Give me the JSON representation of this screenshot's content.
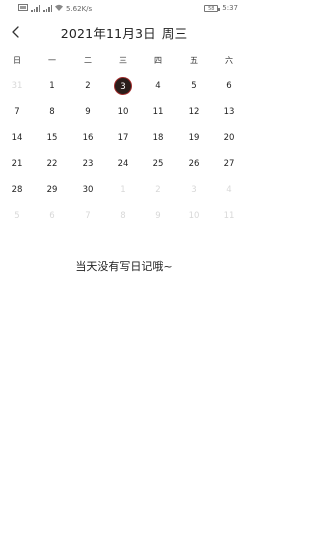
{
  "status_bar": {
    "left_icons": [
      "sim-icon",
      "signal-icon",
      "signal-icon",
      "wifi-icon"
    ],
    "network_speed": "5.62K/s",
    "battery_level": "58",
    "time": "5:37"
  },
  "header": {
    "title_date": "2021年11月3日",
    "title_weekday": "周三",
    "back_icon": "chevron-left-icon"
  },
  "weekdays": [
    "日",
    "一",
    "二",
    "三",
    "四",
    "五",
    "六"
  ],
  "calendar": {
    "selected_day": "3",
    "weeks": [
      [
        {
          "d": "31",
          "o": true
        },
        {
          "d": "1"
        },
        {
          "d": "2"
        },
        {
          "d": "3",
          "sel": true
        },
        {
          "d": "4"
        },
        {
          "d": "5"
        },
        {
          "d": "6"
        }
      ],
      [
        {
          "d": "7"
        },
        {
          "d": "8"
        },
        {
          "d": "9"
        },
        {
          "d": "10"
        },
        {
          "d": "11"
        },
        {
          "d": "12"
        },
        {
          "d": "13"
        }
      ],
      [
        {
          "d": "14"
        },
        {
          "d": "15"
        },
        {
          "d": "16"
        },
        {
          "d": "17"
        },
        {
          "d": "18"
        },
        {
          "d": "19"
        },
        {
          "d": "20"
        }
      ],
      [
        {
          "d": "21"
        },
        {
          "d": "22"
        },
        {
          "d": "23"
        },
        {
          "d": "24"
        },
        {
          "d": "25"
        },
        {
          "d": "26"
        },
        {
          "d": "27"
        }
      ],
      [
        {
          "d": "28"
        },
        {
          "d": "29"
        },
        {
          "d": "30"
        },
        {
          "d": "1",
          "o": true
        },
        {
          "d": "2",
          "o": true
        },
        {
          "d": "3",
          "o": true
        },
        {
          "d": "4",
          "o": true
        }
      ],
      [
        {
          "d": "5",
          "o": true
        },
        {
          "d": "6",
          "o": true
        },
        {
          "d": "7",
          "o": true
        },
        {
          "d": "8",
          "o": true
        },
        {
          "d": "9",
          "o": true
        },
        {
          "d": "10",
          "o": true
        },
        {
          "d": "11",
          "o": true
        }
      ]
    ]
  },
  "empty_message": "当天没有写日记哦~",
  "colors": {
    "selected_fill": "#2a1d1a",
    "selected_ring": "#a02a2a",
    "other_month_text": "#d8d8d8"
  }
}
